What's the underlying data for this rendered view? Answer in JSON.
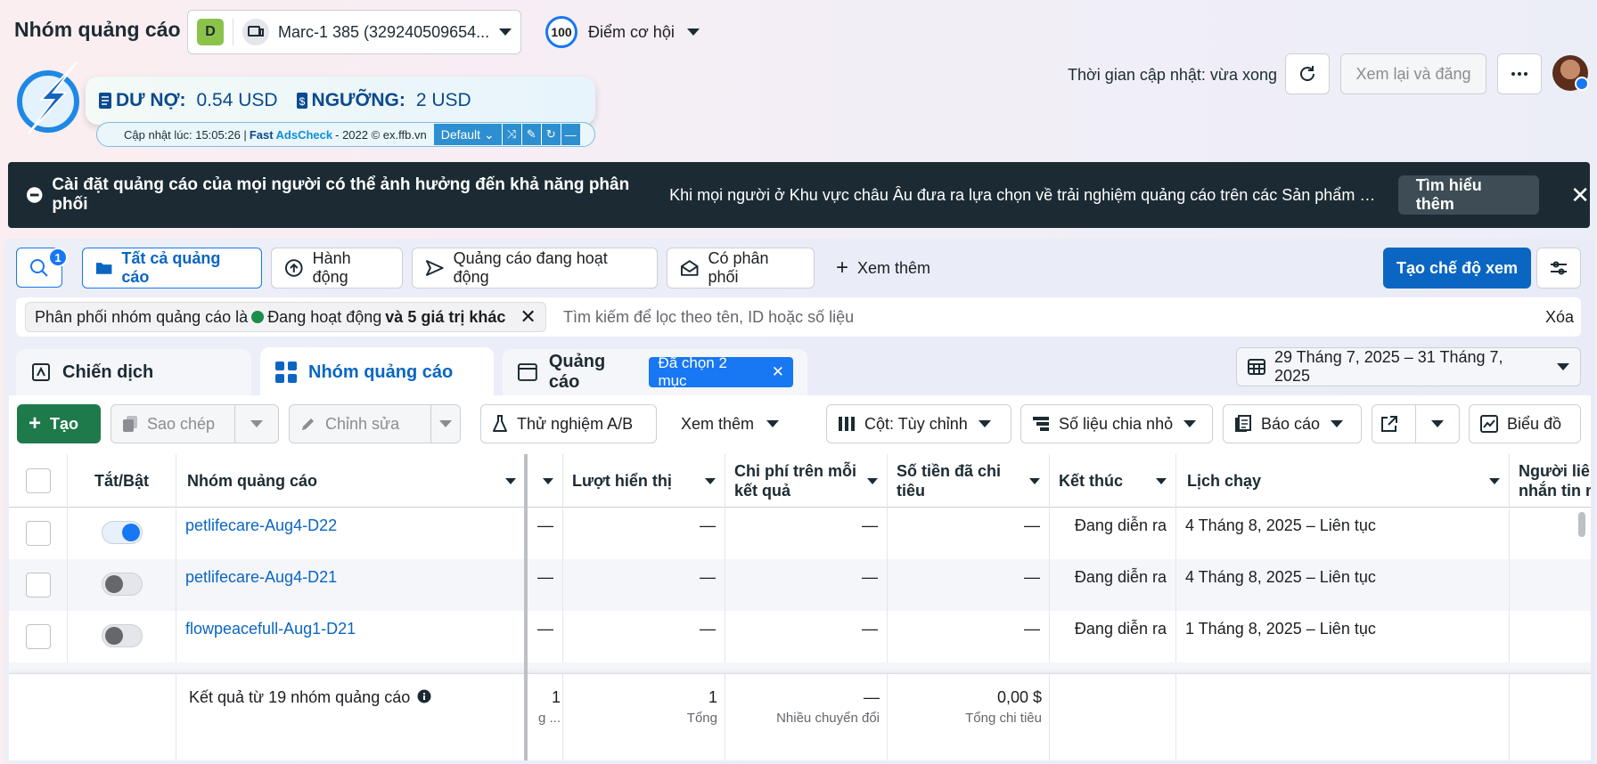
{
  "header": {
    "title": "Nhóm quảng cáo",
    "account_badge": "D",
    "account_name": "Marc-1 385 (329240509654...",
    "opportunity_score": "100",
    "opportunity_label": "Điểm cơ hội",
    "update_time": "Thời gian cập nhật: vừa xong",
    "review_button": "Xem lại và đăng"
  },
  "plugin": {
    "debt_label": "DƯ NỢ:",
    "debt_value": "0.54 USD",
    "threshold_label": "NGƯỠNG:",
    "threshold_value": "2 USD",
    "updated_prefix": "Cập nhật lúc: 15:05:26 |",
    "brand_fast": "Fast",
    "brand_ads": "AdsCheck",
    "copyright": "- 2022 © ex.ffb.vn",
    "preset": "Default"
  },
  "banner": {
    "title": "Cài đặt quảng cáo của mọi người có thể ảnh hưởng đến khả năng phân phối",
    "description": "Khi mọi người ở Khu vực châu Âu đưa ra lựa chọn về trải nghiệm quảng cáo trên các Sản phẩm của chún...",
    "learn_more": "Tìm hiểu thêm"
  },
  "filters": {
    "search_badge": "1",
    "all_ads": "Tất cả quảng cáo",
    "actions": "Hành động",
    "active_ads": "Quảng cáo đang hoạt động",
    "delivering": "Có phân phối",
    "see_more": "Xem thêm",
    "create_view": "Tạo chế độ xem",
    "chip_prefix": "Phân phối nhóm quảng cáo là",
    "chip_value": "Đang hoạt động",
    "chip_more": "và 5 giá trị khác",
    "search_placeholder": "Tìm kiếm để lọc theo tên, ID hoặc số liệu",
    "clear": "Xóa"
  },
  "tabs": {
    "campaigns": "Chiến dịch",
    "adsets": "Nhóm quảng cáo",
    "ads": "Quảng cáo",
    "selected": "Đã chọn 2 mục"
  },
  "date_range": "29 Tháng 7, 2025 – 31 Tháng 7, 2025",
  "toolbar": {
    "create": "Tạo",
    "copy": "Sao chép",
    "edit": "Chỉnh sửa",
    "ab_test": "Thử nghiệm A/B",
    "more": "Xem thêm",
    "columns": "Cột: Tùy chỉnh",
    "breakdown": "Số liệu chia nhỏ",
    "reports": "Báo cáo",
    "charts": "Biểu đồ"
  },
  "table": {
    "headers": {
      "toggle": "Tắt/Bật",
      "name": "Nhóm quảng cáo",
      "impressions": "Lượt hiển thị",
      "cost_per_result_1": "Chi phí trên mỗi",
      "cost_per_result_2": "kết quả",
      "spent_1": "Số tiền đã chi",
      "spent_2": "tiêu",
      "ends": "Kết thúc",
      "schedule": "Lịch chạy",
      "recipients_1": "Người liên",
      "recipients_2": "nhắn tin m"
    },
    "rows": [
      {
        "name": "petlifecare-Aug4-D22",
        "dash": "—",
        "ends": "Đang diễn ra",
        "schedule": "4 Tháng 8, 2025 – Liên tục"
      },
      {
        "name": "petlifecare-Aug4-D21",
        "dash": "—",
        "ends": "Đang diễn ra",
        "schedule": "4 Tháng 8, 2025 – Liên tục"
      },
      {
        "name": "flowpeacefull-Aug1-D21",
        "dash": "—",
        "ends": "Đang diễn ra",
        "schedule": "1 Tháng 8, 2025 – Liên tục"
      }
    ],
    "footer": {
      "results": "Kết quả từ 19 nhóm quảng cáo",
      "impr_total": "1",
      "impr_sub": "Tổng",
      "partial_value": "1",
      "partial_sub": "g ...",
      "cpr": "—",
      "cpr_sub": "Nhiều chuyển đổi",
      "spent": "0,00 $",
      "spent_sub": "Tổng chi tiêu"
    }
  }
}
